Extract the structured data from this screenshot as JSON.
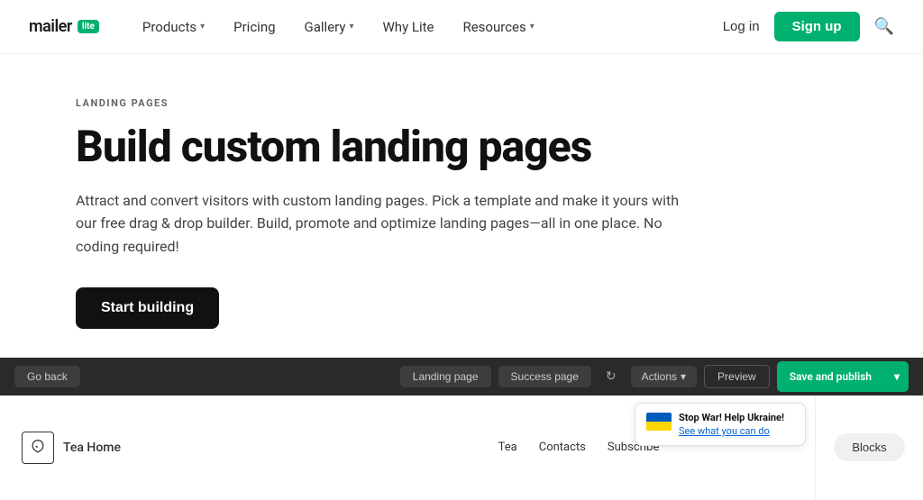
{
  "header": {
    "logo_text": "mailer",
    "logo_badge": "lite",
    "nav": [
      {
        "label": "Products",
        "has_dropdown": true
      },
      {
        "label": "Pricing",
        "has_dropdown": false
      },
      {
        "label": "Gallery",
        "has_dropdown": true
      },
      {
        "label": "Why Lite",
        "has_dropdown": false
      },
      {
        "label": "Resources",
        "has_dropdown": true
      }
    ],
    "login_label": "Log in",
    "signup_label": "Sign up"
  },
  "hero": {
    "label": "LANDING PAGES",
    "title": "Build custom landing pages",
    "description": "Attract and convert visitors with custom landing pages. Pick a template and make it yours with our free drag & drop builder. Build, promote and optimize landing pages—all in one place. No coding required!",
    "cta_label": "Start building"
  },
  "preview": {
    "toolbar": {
      "go_back": "Go back",
      "landing_page_tab": "Landing page",
      "success_page_tab": "Success page",
      "actions_label": "Actions",
      "preview_label": "Preview",
      "save_publish_label": "Save and publish"
    },
    "canvas": {
      "logo_name": "Tea Home",
      "nav_items": [
        "Tea",
        "Contacts",
        "Subscribe"
      ]
    },
    "blocks_panel": {
      "label": "Blocks"
    },
    "ukraine_banner": {
      "title": "Stop War! Help Ukraine!",
      "link_text": "See what you can do"
    }
  },
  "colors": {
    "green": "#00b06e",
    "dark": "#111111",
    "text": "#444444"
  }
}
